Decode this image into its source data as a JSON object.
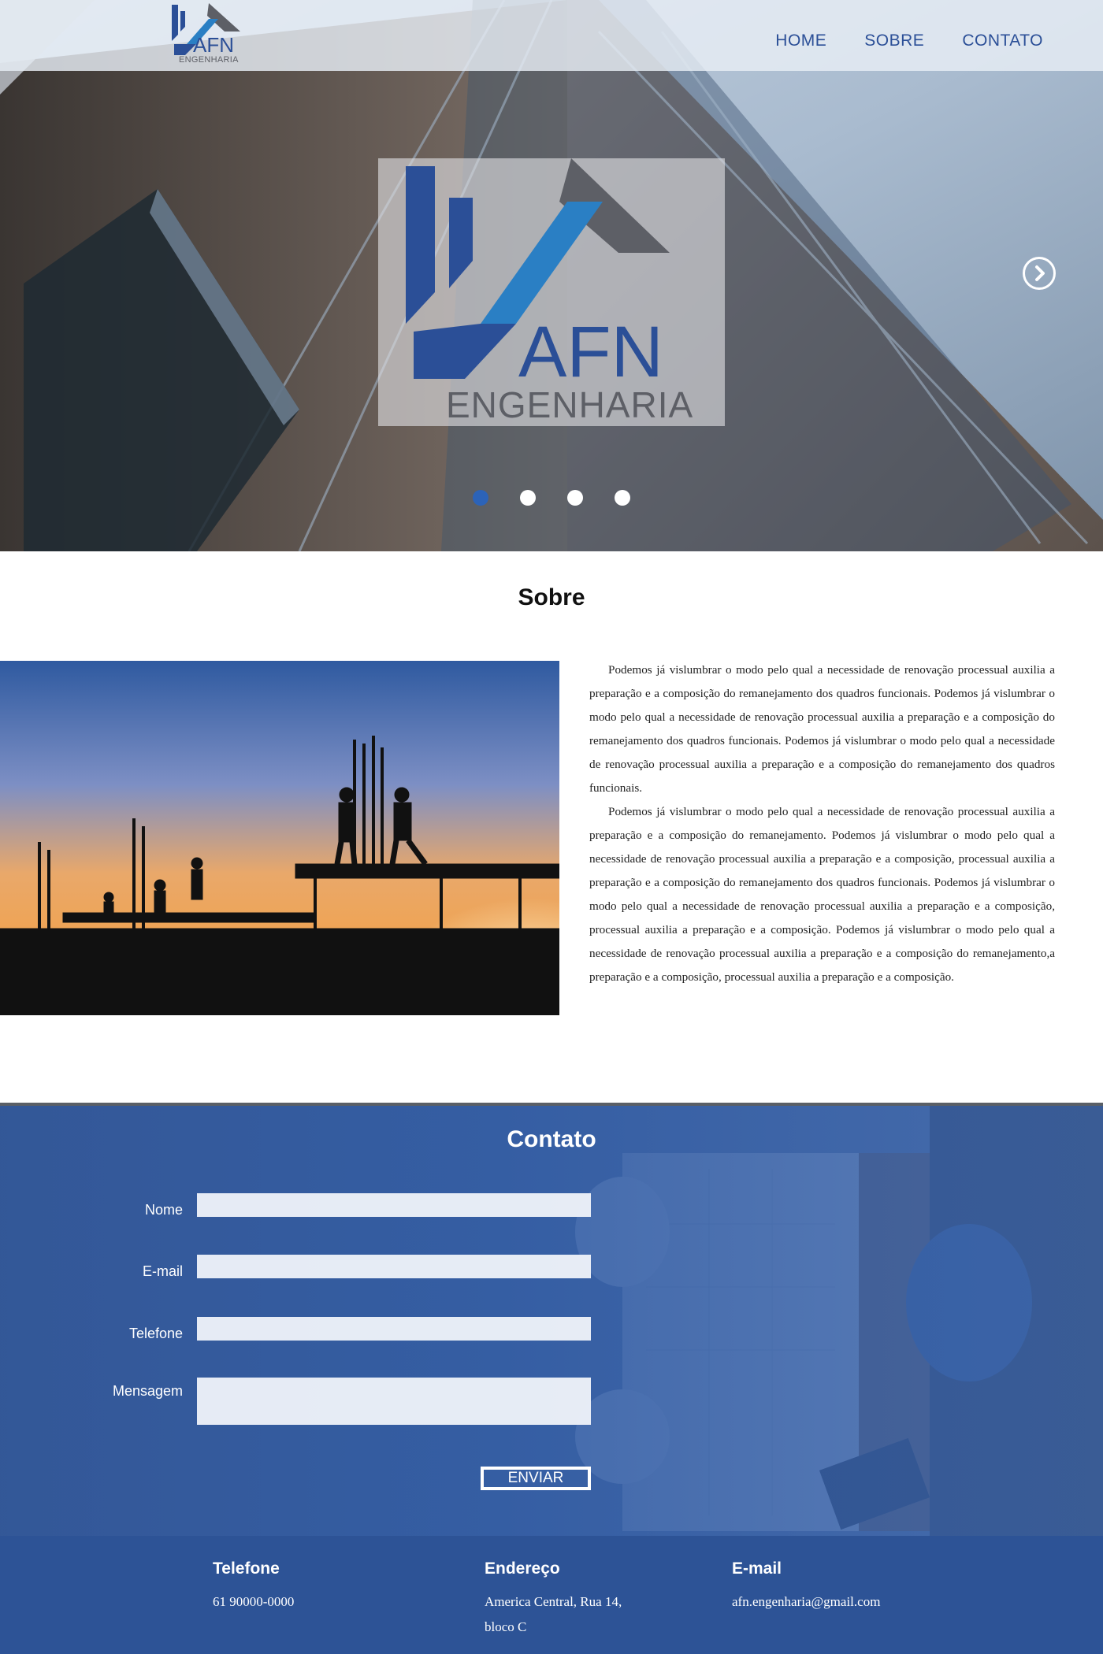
{
  "nav": {
    "items": [
      "HOME",
      "SOBRE",
      "CONTATO"
    ]
  },
  "brand": {
    "logo_text": "AFN",
    "logo_subtext": "ENGENHARIA"
  },
  "hero": {
    "logo_text": "AFN",
    "logo_subtext": "ENGENHARIA",
    "next_icon": "chevron-right-icon",
    "slides_total": 4,
    "active_slide": 1
  },
  "sobre": {
    "title": "Sobre",
    "paragraph_1": "Podemos já vislumbrar o modo pelo qual a necessidade de renovação processual auxilia a preparação e a composição do remanejamento dos quadros funcionais. Podemos já vislumbrar o modo pelo qual a necessidade de renovação processual auxilia a preparação e a composição do remanejamento dos quadros funcionais. Podemos já vislumbrar o modo pelo qual a necessidade de renovação processual auxilia a preparação e a composição do remanejamento dos quadros funcionais.",
    "paragraph_2": "Podemos já vislumbrar o modo pelo qual a necessidade de renovação processual auxilia a preparação e a composição do remanejamento. Podemos já vislumbrar o modo pelo qual a necessidade de renovação processual auxilia a preparação e a composição, processual auxilia a preparação e a composição do remanejamento dos quadros funcionais. Podemos já vislumbrar o modo pelo qual a necessidade de renovação processual auxilia a preparação e a composição, processual auxilia a preparação e a composição. Podemos já vislumbrar o modo pelo qual a necessidade de renovação processual auxilia a preparação e a composição do remanejamento,a preparação e a composição, processual auxilia a preparação e a composição."
  },
  "contato": {
    "title": "Contato",
    "labels": {
      "nome": "Nome",
      "email": "E-mail",
      "telefone": "Telefone",
      "mensagem": "Mensagem"
    },
    "submit_label": "ENVIAR"
  },
  "footer": {
    "telefone_title": "Telefone",
    "telefone_value": "61 90000-0000",
    "endereco_title": "Endereço",
    "endereco_line1": "America Central, Rua 14,",
    "endereco_line2": "bloco C",
    "email_title": "E-mail",
    "email_value": "afn.engenharia@gmail.com"
  },
  "colors": {
    "brand_blue": "#2b4f97",
    "accent_blue": "#2c63b8",
    "footer_blue": "#2d5396",
    "logo_gray": "#5d5f66"
  }
}
